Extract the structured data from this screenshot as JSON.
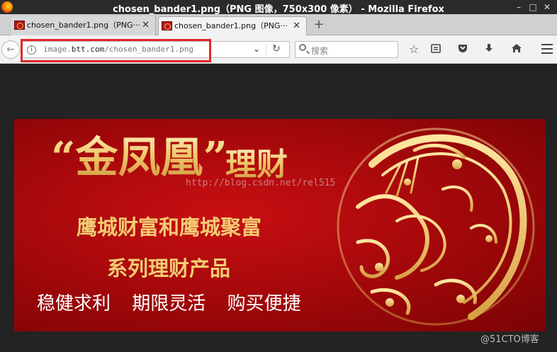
{
  "window": {
    "title": "chosen_bander1.png（PNG 图像，750x300 像素） - Mozilla Firefox",
    "minimize": "–",
    "maximize": "□",
    "close": "✕"
  },
  "tabs": [
    {
      "label": "chosen_bander1.png（PNG···",
      "close": "✕",
      "active": false
    },
    {
      "label": "chosen_bander1.png（PNG···",
      "close": "✕",
      "active": true
    }
  ],
  "new_tab": "+",
  "navbar": {
    "back": "←",
    "url_prefix": "image.",
    "url_domain": "btt.com",
    "url_path": "/chosen_bander1.png",
    "dropdown": "⌄",
    "reload": "↻",
    "search_placeholder": "搜索"
  },
  "banner": {
    "brand": "“金凤凰”",
    "brand_suffix": "理财",
    "line1": "鹰城财富和鹰城聚富",
    "line2": "系列理财产品",
    "slogans": [
      "稳健求利",
      "期限灵活",
      "购买便捷"
    ],
    "watermark": "http://blog.csdn.net/rel515"
  },
  "corner_watermark": "@51CTO博客",
  "colors": {
    "banner_red": "#b0090c",
    "gold": "#f3cc73",
    "highlight_red": "#e2262b"
  },
  "icons": [
    "firefox-logo-icon",
    "image-favicon-icon",
    "info-icon",
    "search-icon",
    "star-icon",
    "reading-list-icon",
    "pocket-icon",
    "download-icon",
    "home-icon",
    "hamburger-menu-icon"
  ]
}
